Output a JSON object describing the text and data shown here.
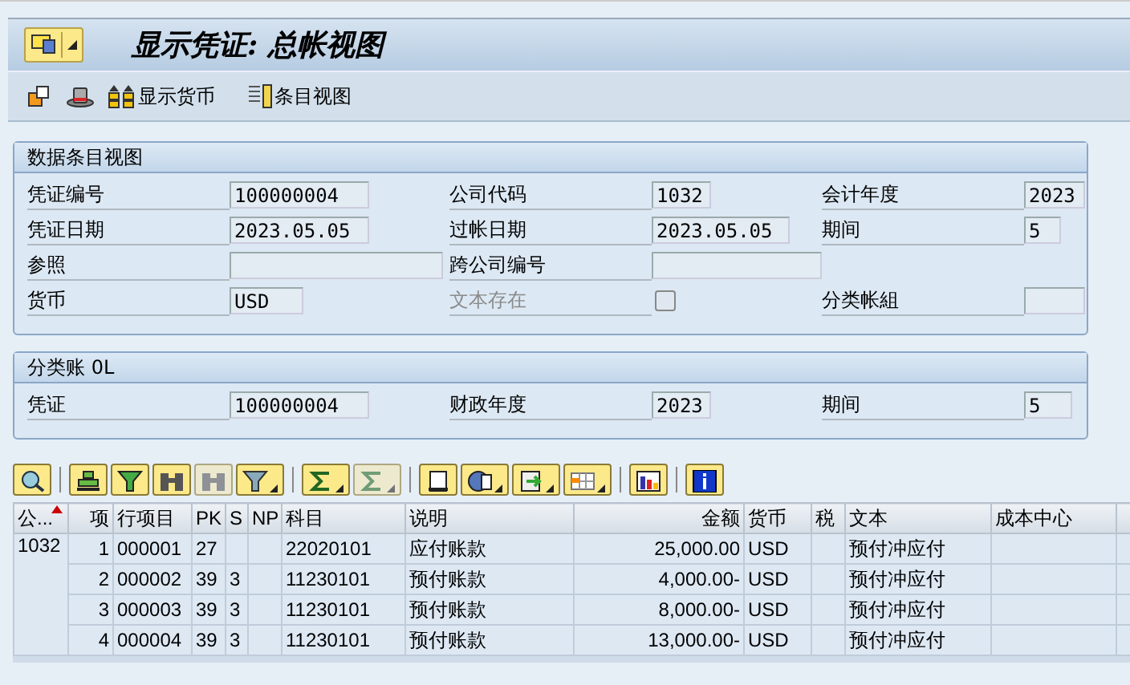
{
  "title_bar": {
    "title": "显示凭证: 总帐视图"
  },
  "toolbar": [
    {
      "label": "显示货币"
    },
    {
      "label": "条目视图"
    }
  ],
  "groups": [
    {
      "title": "数据条目视图",
      "rows": [
        [
          {
            "kind": "field",
            "label": "凭证编号",
            "value": "100000004",
            "disabled": false
          },
          {
            "kind": "field",
            "label": "公司代码",
            "value": "1032",
            "disabled": false
          },
          {
            "kind": "field",
            "label": "会计年度",
            "value": "2023",
            "disabled": false
          }
        ],
        [
          {
            "kind": "field",
            "label": "凭证日期",
            "value": "2023.05.05",
            "disabled": false
          },
          {
            "kind": "field",
            "label": "过帐日期",
            "value": "2023.05.05",
            "disabled": false
          },
          {
            "kind": "field",
            "label": "期间",
            "value": "5",
            "disabled": false
          }
        ],
        [
          {
            "kind": "field",
            "label": "参照",
            "disabled": false
          },
          {
            "kind": "field",
            "label": "跨公司编号",
            "disabled": false
          }
        ],
        [
          {
            "kind": "field",
            "label": "货币",
            "value": "USD",
            "disabled": false
          },
          {
            "kind": "checkbox",
            "label": "文本存在",
            "checked": false,
            "disabled": true
          },
          {
            "kind": "field",
            "label": "分类帐組",
            "disabled": false
          }
        ]
      ]
    },
    {
      "title": "分类账 0L",
      "rows": [
        [
          {
            "kind": "field",
            "label": "凭证",
            "value": "100000004",
            "disabled": false
          },
          {
            "kind": "field",
            "label": "财政年度",
            "value": "2023",
            "disabled": false
          },
          {
            "kind": "field",
            "label": "期间",
            "value": "5",
            "disabled": false
          }
        ]
      ]
    }
  ],
  "grid_toolbar": [
    [
      {
        "menu": false,
        "disabled": false
      }
    ],
    [
      {
        "menu": false,
        "disabled": false
      },
      {
        "menu": false,
        "disabled": false
      },
      {
        "menu": false,
        "disabled": false
      },
      {
        "menu": false,
        "disabled": true
      },
      {
        "menu": true,
        "disabled": false
      }
    ],
    [
      {
        "menu": true,
        "disabled": false
      },
      {
        "menu": true,
        "disabled": true
      }
    ],
    [
      {
        "menu": false,
        "disabled": false
      },
      {
        "menu": true,
        "disabled": false
      },
      {
        "menu": true,
        "disabled": false
      },
      {
        "menu": true,
        "disabled": false
      }
    ],
    [
      {
        "menu": false,
        "disabled": false
      }
    ],
    [
      {
        "menu": false,
        "disabled": false
      }
    ]
  ],
  "table": {
    "columns": [
      {
        "label": "公...",
        "sorted": true
      },
      {
        "label": "项",
        "sorted": false
      },
      {
        "label": "行项目",
        "sorted": false
      },
      {
        "label": "PK",
        "sorted": false
      },
      {
        "label": "S",
        "sorted": false
      },
      {
        "label": "NP",
        "sorted": false
      },
      {
        "label": "科目",
        "sorted": false
      },
      {
        "label": "说明",
        "sorted": false
      },
      {
        "label": "金额",
        "sorted": false
      },
      {
        "label": "货币",
        "sorted": false
      },
      {
        "label": "税",
        "sorted": false
      },
      {
        "label": "文本",
        "sorted": false
      },
      {
        "label": "成本中心",
        "sorted": false
      }
    ],
    "rows": [
      {
        "cells": [
          {
            "text": "1032",
            "rowspan": 4
          },
          "1",
          "000001",
          "27",
          "",
          "",
          "22020101",
          "应付账款",
          "25,000.00",
          "USD",
          "",
          "预付冲应付",
          ""
        ]
      },
      {
        "cells": [
          "2",
          "000002",
          "39",
          "3",
          "",
          "11230101",
          "预付账款",
          "4,000.00-",
          "USD",
          "",
          "预付冲应付",
          ""
        ]
      },
      {
        "cells": [
          "3",
          "000003",
          "39",
          "3",
          "",
          "11230101",
          "预付账款",
          "8,000.00-",
          "USD",
          "",
          "预付冲应付",
          ""
        ]
      },
      {
        "cells": [
          "4",
          "000004",
          "39",
          "3",
          "",
          "11230101",
          "预付账款",
          "13,000.00-",
          "USD",
          "",
          "预付冲应付",
          ""
        ]
      }
    ]
  }
}
